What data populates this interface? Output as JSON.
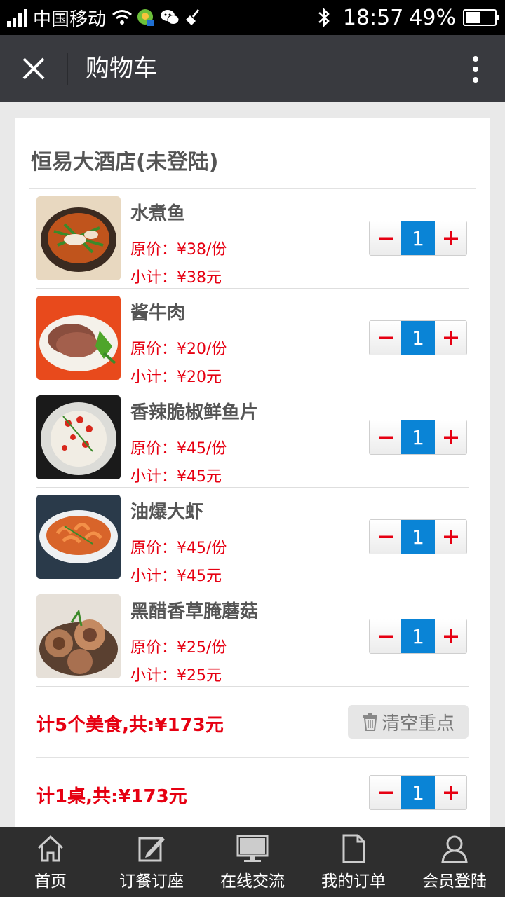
{
  "status_bar": {
    "carrier": "中国移动",
    "time": "18:57",
    "battery_percent": "49%",
    "battery_level": 0.49,
    "icons": [
      "signal-icon",
      "wifi-icon",
      "app-notification-icon",
      "wechat-icon",
      "broom-icon",
      "bluetooth-icon",
      "battery-icon"
    ]
  },
  "title_bar": {
    "title": "购物车",
    "close_icon": "close-icon",
    "more_icon": "more-vertical-icon"
  },
  "store": {
    "name": "恒易大酒店(未登陆)"
  },
  "items": [
    {
      "name": "水煮鱼",
      "price": "原价：¥38/份",
      "subtotal": "小计：¥38元",
      "qty": "1"
    },
    {
      "name": "酱牛肉",
      "price": "原价：¥20/份",
      "subtotal": "小计：¥20元",
      "qty": "1"
    },
    {
      "name": "香辣脆椒鲜鱼片",
      "price": "原价：¥45/份",
      "subtotal": "小计：¥45元",
      "qty": "1"
    },
    {
      "name": "油爆大虾",
      "price": "原价：¥45/份",
      "subtotal": "小计：¥45元",
      "qty": "1"
    },
    {
      "name": "黑醋香草腌蘑菇",
      "price": "原价：¥25/份",
      "subtotal": "小计：¥25元",
      "qty": "1"
    }
  ],
  "summary": {
    "food_total": "计5个美食,共:¥173元",
    "clear_label": "清空重点",
    "table_total": "计1桌,共:¥173元",
    "table_qty": "1"
  },
  "colors": {
    "accent_blue": "#0a84d6",
    "price_red": "#e60012",
    "title_bar": "#393a3f",
    "nav_bar": "#2e2e2e"
  },
  "bottom_nav": [
    {
      "label": "首页",
      "icon": "home-icon"
    },
    {
      "label": "订餐订座",
      "icon": "edit-icon"
    },
    {
      "label": "在线交流",
      "icon": "monitor-icon"
    },
    {
      "label": "我的订单",
      "icon": "document-icon"
    },
    {
      "label": "会员登陆",
      "icon": "user-icon"
    }
  ]
}
